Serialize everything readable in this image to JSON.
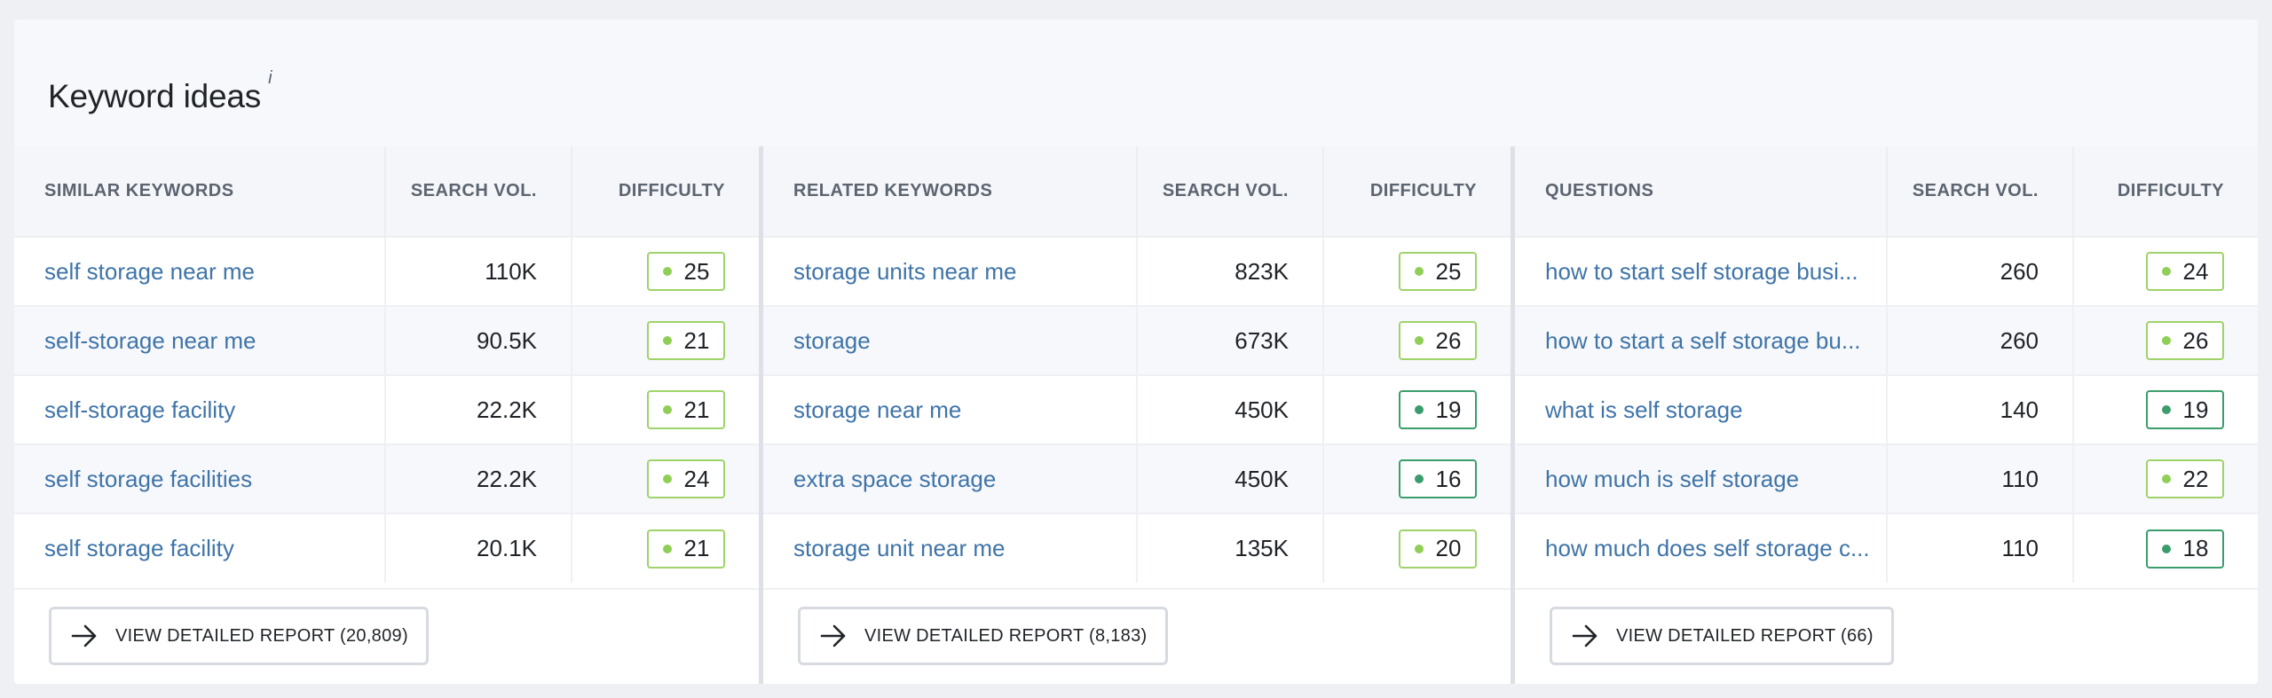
{
  "title": "Keyword ideas",
  "info_marker": "i",
  "panels": [
    {
      "headers": [
        "SIMILAR KEYWORDS",
        "SEARCH VOL.",
        "DIFFICULTY"
      ],
      "rows": [
        {
          "keyword": "self storage near me",
          "volume": "110K",
          "difficulty": "25",
          "level": "light"
        },
        {
          "keyword": "self-storage near me",
          "volume": "90.5K",
          "difficulty": "21",
          "level": "light"
        },
        {
          "keyword": "self-storage facility",
          "volume": "22.2K",
          "difficulty": "21",
          "level": "light"
        },
        {
          "keyword": "self storage facilities",
          "volume": "22.2K",
          "difficulty": "24",
          "level": "light"
        },
        {
          "keyword": "self storage facility",
          "volume": "20.1K",
          "difficulty": "21",
          "level": "light"
        }
      ],
      "button_label": "VIEW DETAILED REPORT (20,809)"
    },
    {
      "headers": [
        "RELATED KEYWORDS",
        "SEARCH VOL.",
        "DIFFICULTY"
      ],
      "rows": [
        {
          "keyword": "storage units near me",
          "volume": "823K",
          "difficulty": "25",
          "level": "light"
        },
        {
          "keyword": "storage",
          "volume": "673K",
          "difficulty": "26",
          "level": "light"
        },
        {
          "keyword": "storage near me",
          "volume": "450K",
          "difficulty": "19",
          "level": "dark"
        },
        {
          "keyword": "extra space storage",
          "volume": "450K",
          "difficulty": "16",
          "level": "dark"
        },
        {
          "keyword": "storage unit near me",
          "volume": "135K",
          "difficulty": "20",
          "level": "light"
        }
      ],
      "button_label": "VIEW DETAILED REPORT (8,183)"
    },
    {
      "headers": [
        "QUESTIONS",
        "SEARCH VOL.",
        "DIFFICULTY"
      ],
      "rows": [
        {
          "keyword": "how to start self storage busi...",
          "volume": "260",
          "difficulty": "24",
          "level": "light"
        },
        {
          "keyword": "how to start a self storage bu...",
          "volume": "260",
          "difficulty": "26",
          "level": "light"
        },
        {
          "keyword": "what is self storage",
          "volume": "140",
          "difficulty": "19",
          "level": "dark"
        },
        {
          "keyword": "how much is self storage",
          "volume": "110",
          "difficulty": "22",
          "level": "light"
        },
        {
          "keyword": "how much does self storage c...",
          "volume": "110",
          "difficulty": "18",
          "level": "dark"
        }
      ],
      "button_label": "VIEW DETAILED REPORT (66)"
    }
  ],
  "colors": {
    "link": "#3f74a8",
    "difficulty_light": "#8fcf55",
    "difficulty_dark": "#3a9d6c"
  },
  "icons": {
    "report_button": "arrow-right-icon",
    "difficulty_dot": "dot-icon"
  }
}
